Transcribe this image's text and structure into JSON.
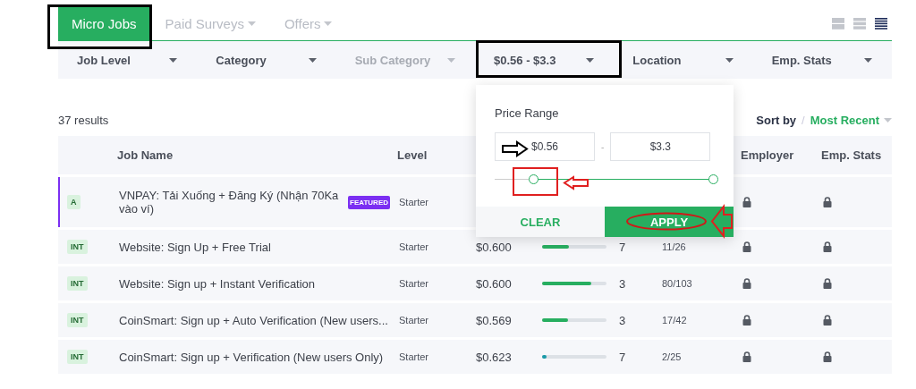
{
  "tabs": [
    {
      "label": "Micro Jobs",
      "selected": true,
      "has_caret": false
    },
    {
      "label": "Paid Surveys",
      "selected": false,
      "has_caret": true
    },
    {
      "label": "Offers",
      "selected": false,
      "has_caret": true
    }
  ],
  "view_modes": [
    {
      "selected": false
    },
    {
      "selected": false
    },
    {
      "selected": true
    }
  ],
  "filters": [
    {
      "label": "Job Level",
      "muted": false
    },
    {
      "label": "Category",
      "muted": false
    },
    {
      "label": "Sub Category",
      "muted": true
    },
    {
      "label": "$0.56 - $3.3",
      "muted": false
    },
    {
      "label": "Location",
      "muted": false
    },
    {
      "label": "Emp. Stats",
      "muted": false
    }
  ],
  "results_count": "37 results",
  "sort": {
    "label": "Sort by",
    "separator": "/",
    "value": "Most Recent"
  },
  "table": {
    "columns": [
      "",
      "Job Name",
      "Level",
      "",
      "",
      "",
      "",
      "Employer",
      "Emp. Stats"
    ],
    "rows": [
      {
        "badge": "A",
        "name": "VNPAY: Tải Xuống + Đăng Ký (Nhận 70Ka vào ví)",
        "featured": "FEATURED",
        "highlighted": true,
        "level_text": "Starter",
        "locked": true
      },
      {
        "badge": "INT",
        "name": "Website: Sign Up + Free Trial",
        "highlighted": false,
        "level_text": "Starter",
        "price": "$0.600",
        "progress": {
          "level": 0.42,
          "color": "#27ae60"
        },
        "count": "7",
        "ratio": "11/26",
        "locked": true
      },
      {
        "badge": "INT",
        "name": "Website: Sign up + Instant Verification",
        "highlighted": false,
        "level_text": "Starter",
        "price": "$0.600",
        "progress": {
          "level": 0.77,
          "color": "#27ae60"
        },
        "count": "3",
        "ratio": "80/103",
        "locked": true
      },
      {
        "badge": "INT",
        "name": "CoinSmart: Sign up + Auto Verification (New users...",
        "highlighted": false,
        "level_text": "Starter",
        "price": "$0.569",
        "progress": {
          "level": 0.4,
          "color": "#27ae60"
        },
        "count": "3",
        "ratio": "17/42",
        "locked": true
      },
      {
        "badge": "INT",
        "name": "CoinSmart: Sign up + Verification (New users Only)",
        "highlighted": false,
        "level_text": "Starter",
        "price": "$0.623",
        "progress": {
          "level": 0.07,
          "color": "#1a9aa8"
        },
        "count": "7",
        "ratio": "2/25",
        "locked": true
      }
    ]
  },
  "price_popup": {
    "title": "Price Range",
    "min_value": "$0.56",
    "separator": "-",
    "max_value": "$3.3",
    "thumbs": [
      {
        "level": 0.18
      },
      {
        "level": 1
      }
    ],
    "clear_label": "CLEAR",
    "apply_label": "APPLY"
  }
}
